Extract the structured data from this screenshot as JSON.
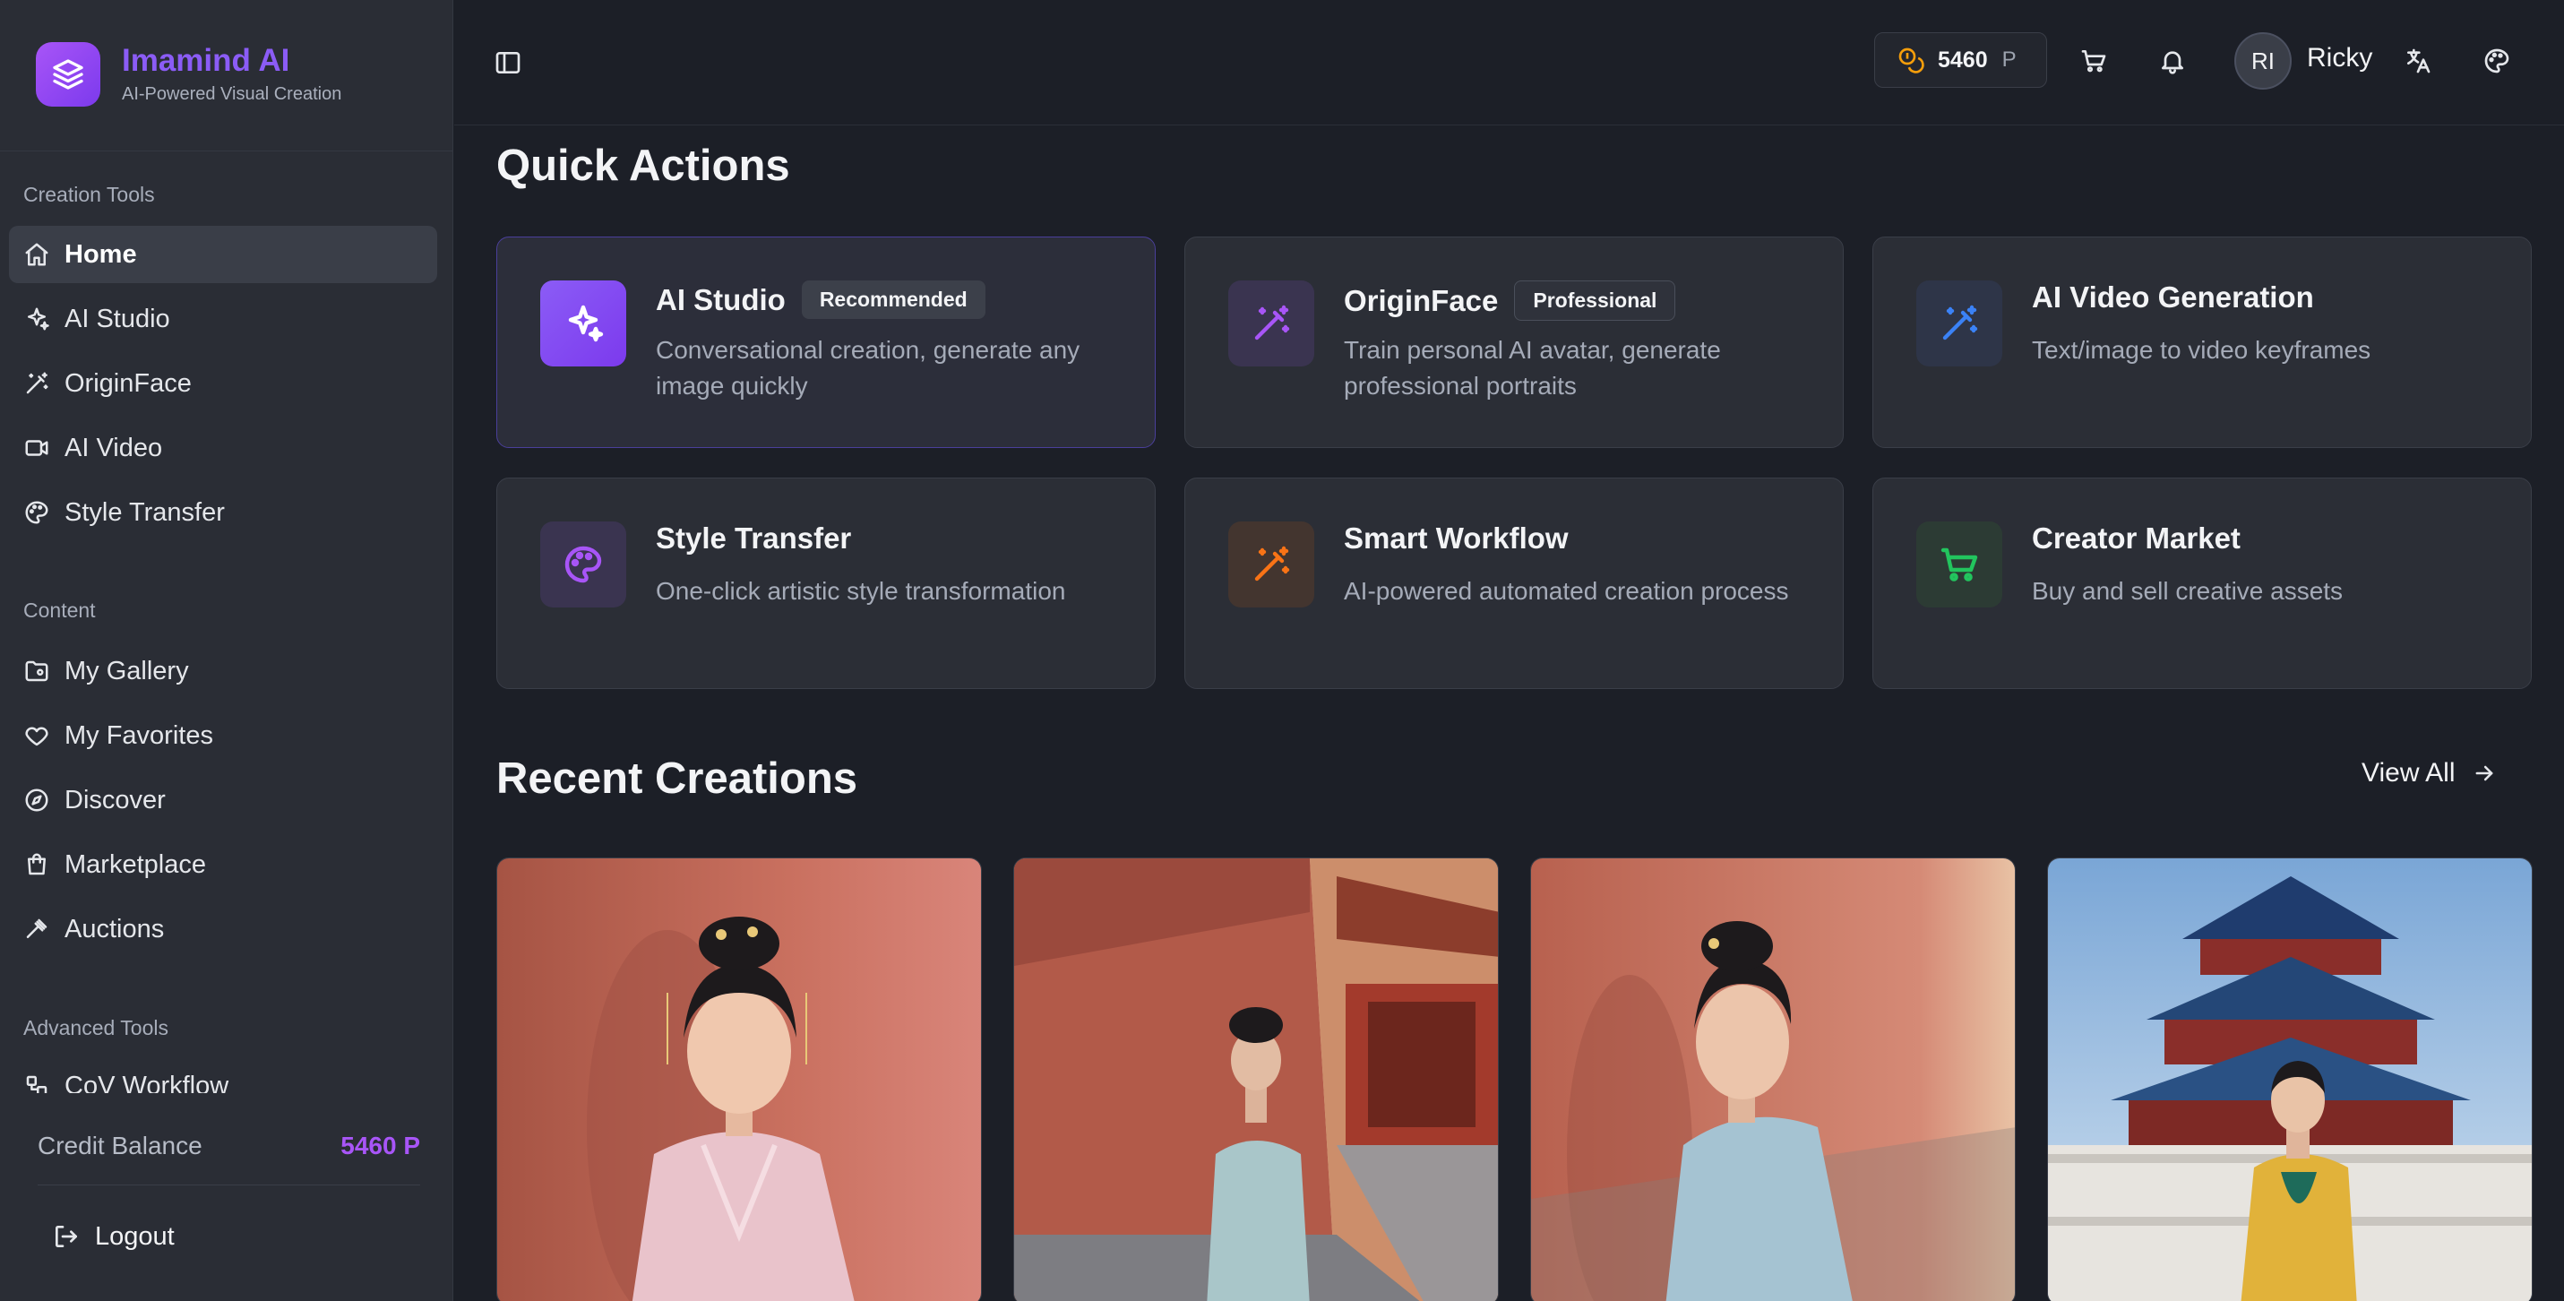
{
  "brand": {
    "name": "Imamind AI",
    "tagline": "AI-Powered Visual Creation"
  },
  "sidebar": {
    "sections": [
      {
        "title": "Creation Tools"
      },
      {
        "title": "Content"
      },
      {
        "title": "Advanced Tools"
      }
    ],
    "creation_items": [
      {
        "label": "Home",
        "icon": "home-icon",
        "active": true
      },
      {
        "label": "AI Studio",
        "icon": "sparkles-icon"
      },
      {
        "label": "OriginFace",
        "icon": "magic-wand-icon"
      },
      {
        "label": "AI Video",
        "icon": "video-icon"
      },
      {
        "label": "Style Transfer",
        "icon": "palette-icon"
      }
    ],
    "content_items": [
      {
        "label": "My Gallery",
        "icon": "folder-image-icon"
      },
      {
        "label": "My Favorites",
        "icon": "heart-icon"
      },
      {
        "label": "Discover",
        "icon": "compass-icon"
      },
      {
        "label": "Marketplace",
        "icon": "store-icon"
      },
      {
        "label": "Auctions",
        "icon": "gavel-icon"
      }
    ],
    "advanced_items": [
      {
        "label": "CoV Workflow",
        "icon": "workflow-icon"
      }
    ],
    "credit_label": "Credit Balance",
    "credit_value": "5460 P",
    "logout_label": "Logout"
  },
  "topbar": {
    "points": "5460",
    "points_unit": "P",
    "avatar_initials": "RI",
    "username": "Ricky"
  },
  "main": {
    "quick_actions_title": "Quick Actions",
    "cards": [
      {
        "title": "AI Studio",
        "badge": "Recommended",
        "desc": "Conversational creation, generate any image quickly",
        "icon": "sparkles-icon",
        "color": "#ffffff"
      },
      {
        "title": "OriginFace",
        "badge": "Professional",
        "desc": "Train personal AI avatar, generate professional portraits",
        "icon": "magic-wand-icon",
        "color": "#a855f7"
      },
      {
        "title": "AI Video Generation",
        "badge": "",
        "desc": "Text/image to video keyframes",
        "icon": "magic-wand-icon",
        "color": "#3b82f6"
      },
      {
        "title": "Style Transfer",
        "badge": "",
        "desc": "One-click artistic style transformation",
        "icon": "palette-icon",
        "color": "#a855f7"
      },
      {
        "title": "Smart Workflow",
        "badge": "",
        "desc": "AI-powered automated creation process",
        "icon": "magic-wand-icon",
        "color": "#f97316"
      },
      {
        "title": "Creator Market",
        "badge": "",
        "desc": "Buy and sell creative assets",
        "icon": "cart-icon",
        "color": "#22c55e"
      }
    ],
    "recent_title": "Recent Creations",
    "view_all": "View All"
  }
}
